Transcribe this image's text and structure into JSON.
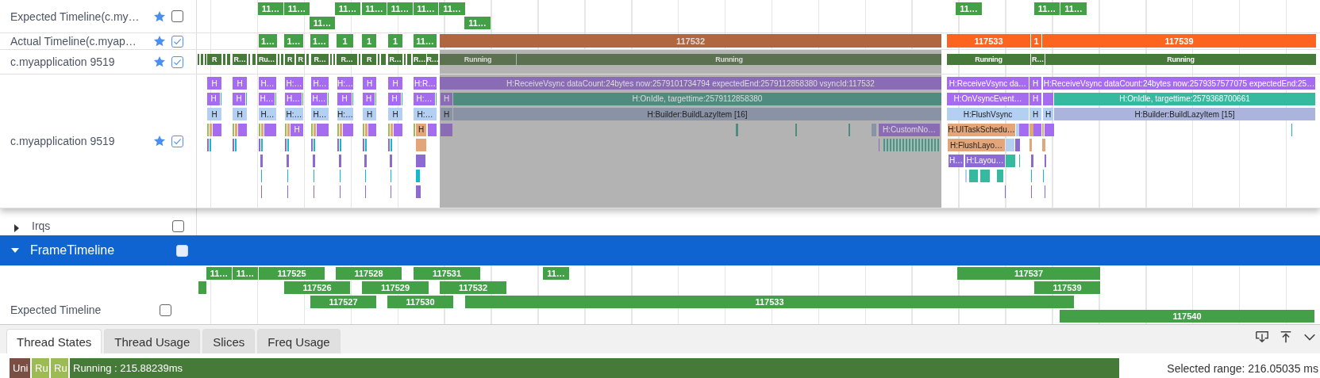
{
  "pinned_tracks": [
    {
      "kind": "expected",
      "label": "Expected Timeline(c.my…",
      "checked": false,
      "slices": [
        "11…",
        "11…",
        "11…",
        "11…",
        "11…",
        "11…",
        "11…",
        "11…",
        "11…",
        "11…",
        "11…",
        "11…"
      ]
    },
    {
      "kind": "actual",
      "label": "Actual Timeline(c.myap…",
      "checked": true,
      "slices": [
        "1…",
        "1…",
        "1…",
        "1",
        "1",
        "1",
        "11…",
        "117532",
        "117533",
        "1",
        "117539"
      ]
    },
    {
      "kind": "thread_state",
      "label": "c.myapplication 9519",
      "checked": true,
      "slices": [
        "R",
        "R…",
        "Ru…",
        "R",
        "R",
        "R…",
        "R…",
        "R",
        "R…",
        "R…",
        "R…",
        "Running",
        "Running",
        "Running",
        "R…",
        "Running"
      ]
    },
    {
      "kind": "slices",
      "label": "c.myapplication 9519",
      "checked": true,
      "slices": [
        "H",
        "H",
        "H…",
        "H:…",
        "H…",
        "H:…",
        "H",
        "H",
        "H:R…",
        "H",
        "H",
        "H…",
        "H…",
        "H…",
        "H",
        "H",
        "H",
        "H:…",
        "H",
        "H",
        "H…",
        "H:…",
        "H…",
        "H:…",
        "H",
        "H",
        "H:…",
        "H",
        "H",
        "H:ReceiveVsync dataCount:24bytes now:2579101734794 expectedEnd:2579112858380 vsyncId:117532",
        "H",
        "H:OnIdle, targettime:2579112858380",
        "H",
        "H:Builder:BuildLazyItem [16]",
        "H:CustomNo…",
        "H:ReceiveVsync da…",
        "H",
        "H:ReceiveVsync dataCount:24bytes now:2579357577075 expectedEnd:25…",
        "H:OnVsyncEvent…",
        "H",
        "H:OnIdle, targettime:2579368700661",
        "H:FlushVsync",
        "H",
        "H",
        "H:Builder:BuildLazyItem [15]",
        "H:UITaskSchedu…",
        "H:FlushLayo…",
        "H…",
        "H:Layou…"
      ]
    }
  ],
  "irqs_row": {
    "label": "Irqs",
    "expanded": false,
    "checked": false
  },
  "frame_timeline": {
    "label": "FrameTimeline",
    "expanded": true,
    "checked": false,
    "expected_timeline": {
      "label": "Expected Timeline",
      "checked": false,
      "slices": [
        "11…",
        "11…",
        "117525",
        "117528",
        "117531",
        "11…",
        "117537",
        "117526",
        "117529",
        "117532",
        "117539",
        "117527",
        "117530",
        "117533",
        "117540"
      ]
    }
  },
  "tabs": [
    {
      "label": "Thread States",
      "selected": true
    },
    {
      "label": "Thread Usage",
      "selected": false
    },
    {
      "label": "Slices",
      "selected": false
    },
    {
      "label": "Freq Usage",
      "selected": false
    }
  ],
  "thread_states_bar": [
    {
      "label": "Uni"
    },
    {
      "label": "Ru"
    },
    {
      "label": "Ru"
    },
    {
      "label": "Running : 215.88239ms"
    }
  ],
  "selected_range": "Selected range: 216.05035 ms"
}
